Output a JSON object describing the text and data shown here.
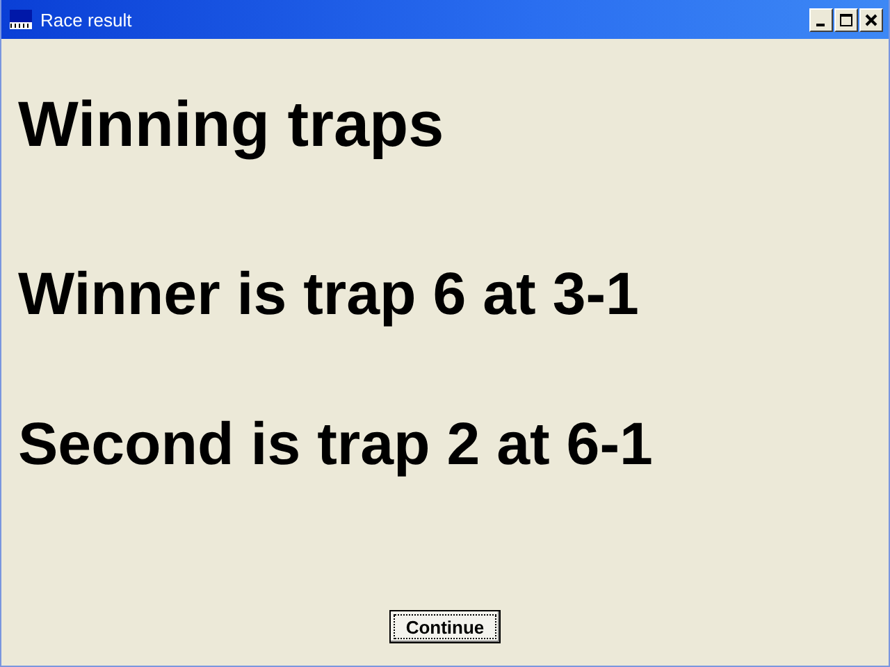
{
  "window": {
    "title": "Race result"
  },
  "heading": "Winning traps",
  "results": [
    "Winner is trap 6 at 3-1",
    "Second is trap 2 at 6-1"
  ],
  "buttons": [
    {
      "label": "Continue",
      "focused": true
    }
  ]
}
